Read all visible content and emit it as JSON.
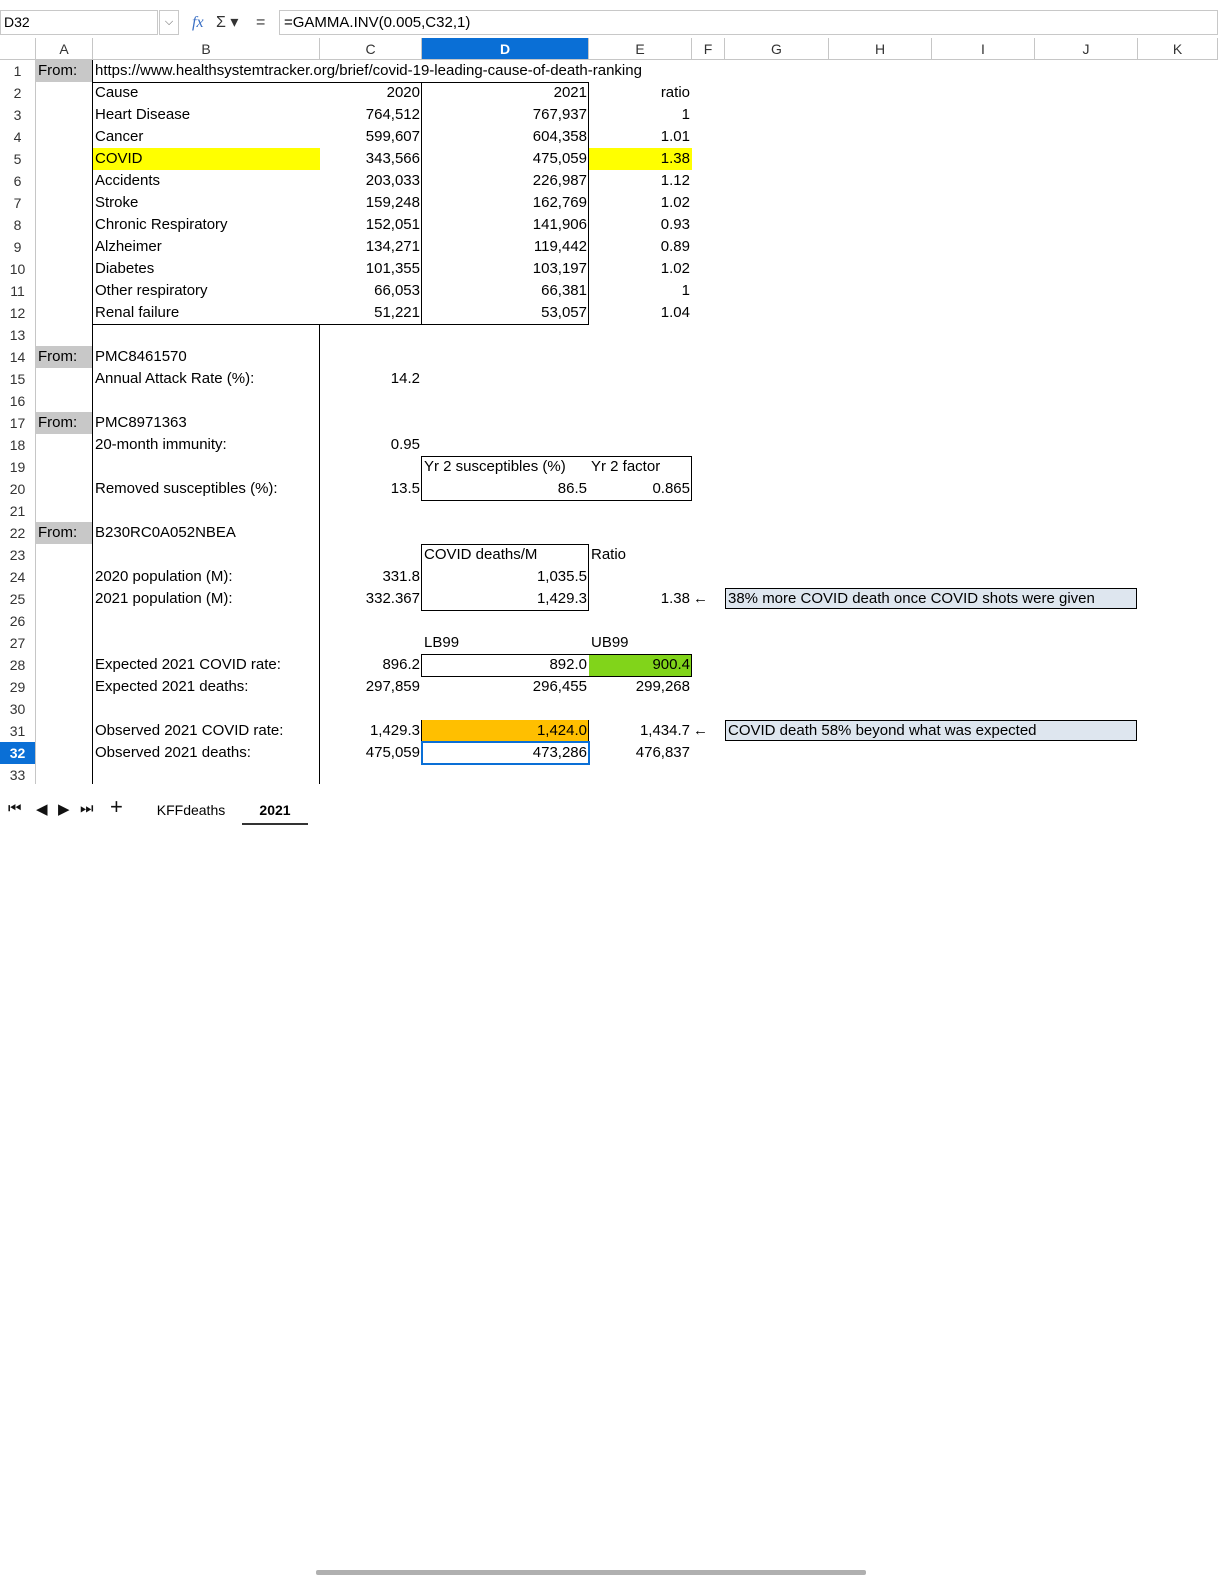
{
  "formula_bar": {
    "name_box": "D32",
    "dropdown_glyph": "⌵",
    "fx_label": "fx",
    "sum_label": "Σ ▾",
    "equals_label": "=",
    "formula": "=GAMMA.INV(0.005,C32,1)"
  },
  "columns": [
    "A",
    "B",
    "C",
    "D",
    "E",
    "F",
    "G",
    "H",
    "I",
    "J",
    "K"
  ],
  "rows": [
    "1",
    "2",
    "3",
    "4",
    "5",
    "6",
    "7",
    "8",
    "9",
    "10",
    "11",
    "12",
    "13",
    "14",
    "15",
    "16",
    "17",
    "18",
    "19",
    "20",
    "21",
    "22",
    "23",
    "24",
    "25",
    "26",
    "27",
    "28",
    "29",
    "30",
    "31",
    "32",
    "33"
  ],
  "cells": {
    "A1": "From:",
    "B1": "https://www.healthsystemtracker.org/brief/covid-19-leading-cause-of-death-ranking",
    "B2": "Cause",
    "C2": "2020",
    "D2": "2021",
    "E2": "ratio",
    "B3": "Heart Disease",
    "C3": "764,512",
    "D3": "767,937",
    "E3": "1",
    "B4": "Cancer",
    "C4": "599,607",
    "D4": "604,358",
    "E4": "1.01",
    "B5": "COVID",
    "C5": "343,566",
    "D5": "475,059",
    "E5": "1.38",
    "B6": "Accidents",
    "C6": "203,033",
    "D6": "226,987",
    "E6": "1.12",
    "B7": "Stroke",
    "C7": "159,248",
    "D7": "162,769",
    "E7": "1.02",
    "B8": "Chronic Respiratory",
    "C8": "152,051",
    "D8": "141,906",
    "E8": "0.93",
    "B9": "Alzheimer",
    "C9": "134,271",
    "D9": "119,442",
    "E9": "0.89",
    "B10": "Diabetes",
    "C10": "101,355",
    "D10": "103,197",
    "E10": "1.02",
    "B11": "Other respiratory",
    "C11": "66,053",
    "D11": "66,381",
    "E11": "1",
    "B12": "Renal failure",
    "C12": "51,221",
    "D12": "53,057",
    "E12": "1.04",
    "A14": "From:",
    "B14": "PMC8461570",
    "B15": "Annual Attack Rate (%):",
    "C15": "14.2",
    "A17": "From:",
    "B17": "PMC8971363",
    "B18": "20-month immunity:",
    "C18": "0.95",
    "D19": "Yr 2 susceptibles (%)",
    "E19": "Yr 2 factor",
    "B20": "Removed susceptibles (%):",
    "C20": "13.5",
    "D20": "86.5",
    "E20": "0.865",
    "A22": "From:",
    "B22": "B230RC0A052NBEA",
    "D23": "COVID deaths/M",
    "E23": "Ratio",
    "B24": "2020 population (M):",
    "C24": "331.8",
    "D24": "1,035.5",
    "B25": "2021 population (M):",
    "C25": "332.367",
    "D25": "1,429.3",
    "E25": "1.38",
    "F25": "←",
    "G25": "38% more COVID death once COVID shots were given",
    "D27": "LB99",
    "E27": "UB99",
    "B28": "Expected 2021 COVID rate:",
    "C28": "896.2",
    "D28": "892.0",
    "E28": "900.4",
    "B29": "Expected 2021 deaths:",
    "C29": "297,859",
    "D29": "296,455",
    "E29": "299,268",
    "B31": "Observed 2021 COVID rate:",
    "C31": "1,429.3",
    "D31": "1,424.0",
    "E31": "1,434.7",
    "F31": "←",
    "G31": "COVID death 58% beyond what was expected",
    "B32": "Observed 2021 deaths:",
    "C32": "475,059",
    "D32": "473,286",
    "E32": "476,837"
  },
  "highlight_colors": {
    "label_gray": "#c8c8c8",
    "covid_yellow": "#ffff00",
    "ub_green": "#81d41a",
    "lb_orange": "#ffbf00",
    "note_blue": "#dee6ef",
    "selection_blue": "#0a6fd6"
  },
  "sheet_tabs": {
    "nav_first": "⏮",
    "nav_prev": "◀",
    "nav_next": "▶",
    "nav_last": "⏭",
    "add": "+",
    "tabs": [
      "KFFdeaths",
      "2021"
    ],
    "active": "2021"
  },
  "active_cell": "D32"
}
